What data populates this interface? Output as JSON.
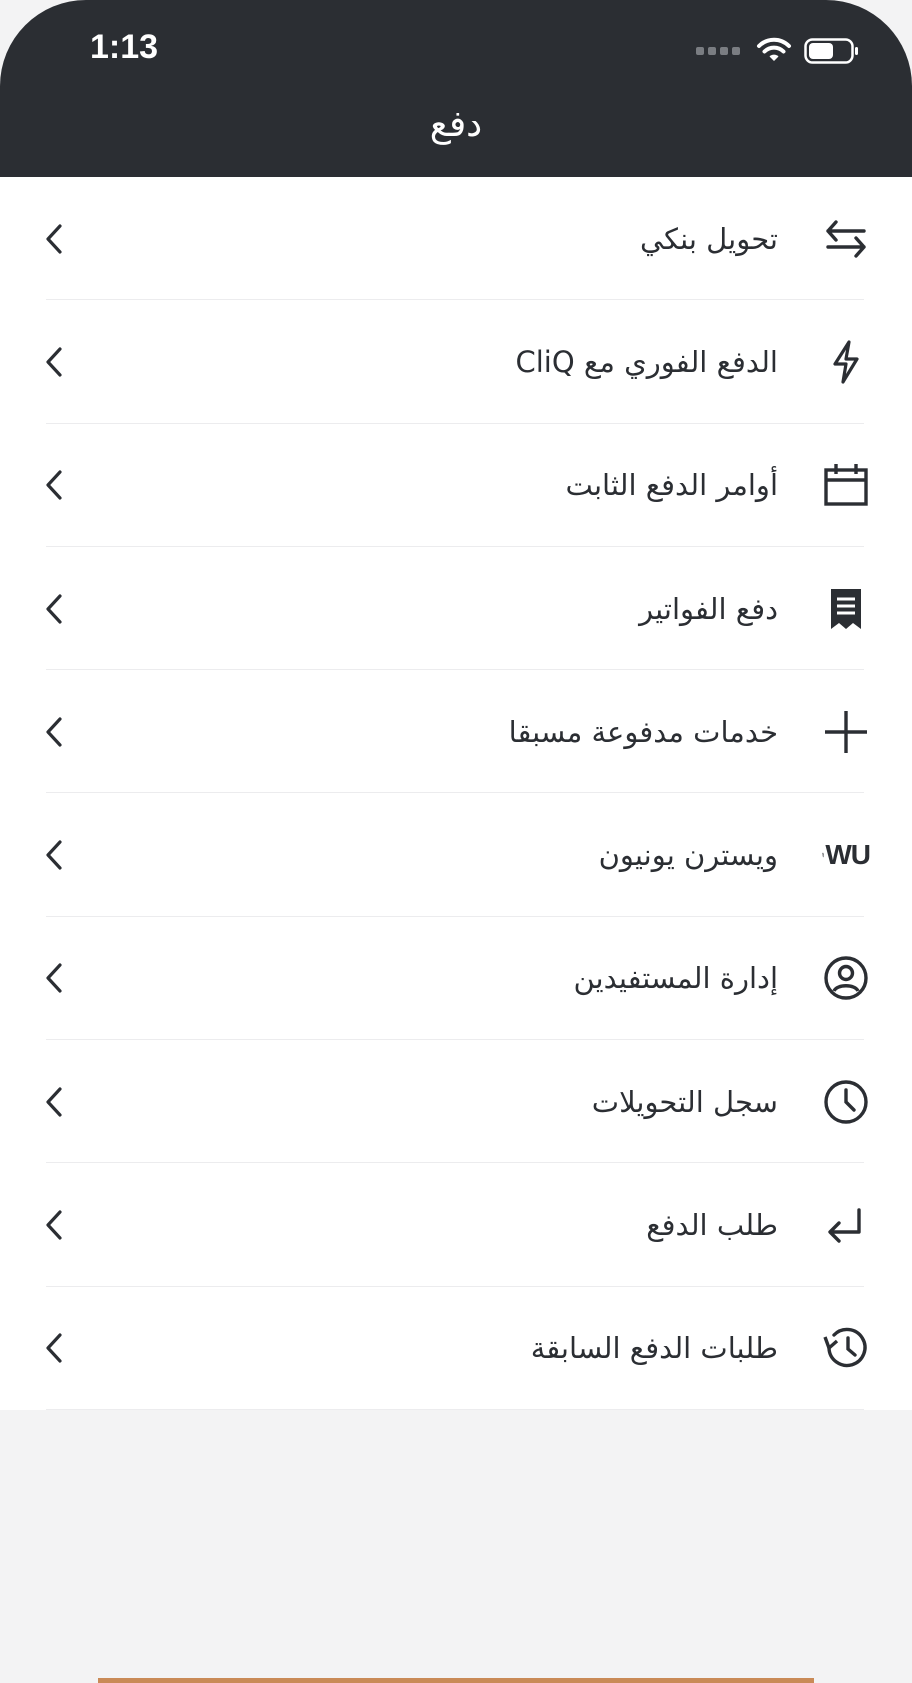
{
  "status_bar": {
    "time": "1:13"
  },
  "header": {
    "title": "دفع"
  },
  "menu": {
    "items": [
      {
        "label": "تحويل بنكي",
        "icon": "transfer-arrows-icon"
      },
      {
        "label": "الدفع الفوري مع CliQ",
        "icon": "lightning-icon"
      },
      {
        "label": "أوامر الدفع الثابت",
        "icon": "calendar-icon"
      },
      {
        "label": "دفع الفواتير",
        "icon": "receipt-icon"
      },
      {
        "label": "خدمات مدفوعة مسبقا",
        "icon": "plus-icon"
      },
      {
        "label": "ويسترن يونيون",
        "icon": "western-union-logo-icon",
        "logo_text": "WU"
      },
      {
        "label": "إدارة المستفيدين",
        "icon": "user-circle-icon"
      },
      {
        "label": "سجل التحويلات",
        "icon": "clock-icon"
      },
      {
        "label": "طلب الدفع",
        "icon": "return-arrow-icon"
      },
      {
        "label": "طلبات الدفع السابقة",
        "icon": "history-icon"
      }
    ]
  },
  "colors": {
    "header_bg": "#2b2e33",
    "text": "#2b2e33",
    "divider": "#ececee",
    "accent": "#c98a57"
  }
}
